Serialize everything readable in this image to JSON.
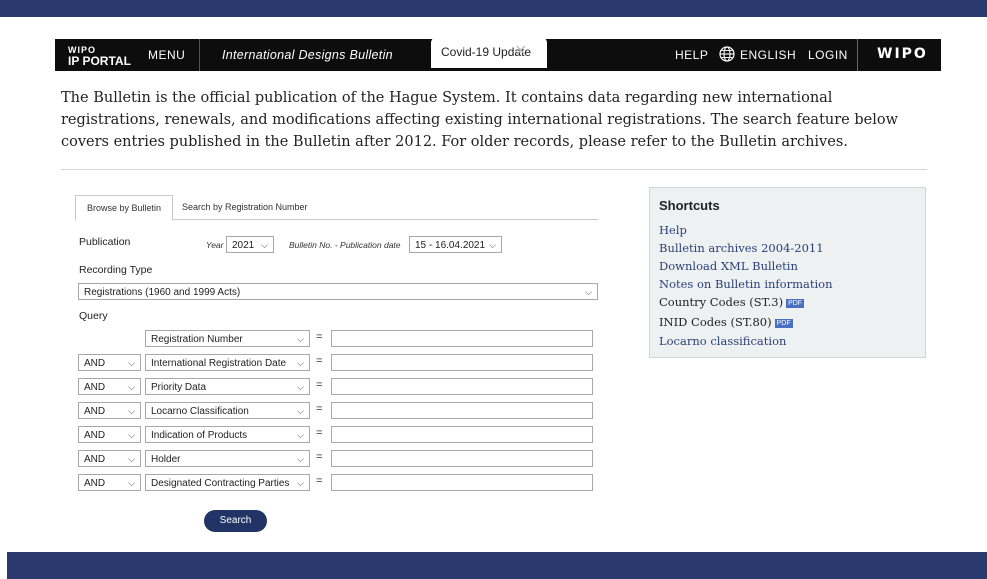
{
  "nav": {
    "logo_line1": "WIPO",
    "logo_line2": "IP PORTAL",
    "menu": "MENU",
    "title": "International Designs Bulletin",
    "covid_tab": "Covid-19 Update",
    "help": "HELP",
    "language": "ENGLISH",
    "login": "LOGIN",
    "wipo": "WIPO"
  },
  "intro": "The Bulletin is the official publication of the Hague System. It contains data regarding new international registrations, renewals, and modifications affecting existing international registrations. The search feature below covers entries published in the Bulletin after 2012. For older records, please refer to the Bulletin archives.",
  "tabs": [
    "Browse by Bulletin",
    "Search by Registration Number"
  ],
  "form": {
    "publication_label": "Publication",
    "year_label": "Year",
    "year_value": "2021",
    "bulletin_label": "Bulletin No. - Publication date",
    "bulletin_value": "15 - 16.04.2021",
    "recording_type_label": "Recording Type",
    "recording_type_value": "Registrations (1960 and 1999 Acts)",
    "query_label": "Query",
    "rows": [
      {
        "operator": "",
        "field": "Registration Number"
      },
      {
        "operator": "AND",
        "field": "International Registration Date"
      },
      {
        "operator": "AND",
        "field": "Priority Data"
      },
      {
        "operator": "AND",
        "field": "Locarno Classification"
      },
      {
        "operator": "AND",
        "field": "Indication of Products"
      },
      {
        "operator": "AND",
        "field": "Holder"
      },
      {
        "operator": "AND",
        "field": "Designated Contracting Parties"
      }
    ],
    "equals": "=",
    "search_button": "Search"
  },
  "shortcuts": {
    "title": "Shortcuts",
    "items": [
      {
        "label": "Help"
      },
      {
        "label": "Bulletin archives 2004-2011"
      },
      {
        "label": "Download XML Bulletin"
      },
      {
        "label": "Notes on Bulletin information"
      },
      {
        "label": "Country Codes (ST.3)",
        "pdf": "PDF"
      },
      {
        "label": "INID Codes (ST.80)",
        "pdf": "PDF"
      },
      {
        "label": "Locarno classification"
      }
    ]
  },
  "colors": {
    "nav_bg": "#0d0d0d",
    "band": "#2a3a6e",
    "button": "#223466",
    "link": "#2b3f7a"
  }
}
